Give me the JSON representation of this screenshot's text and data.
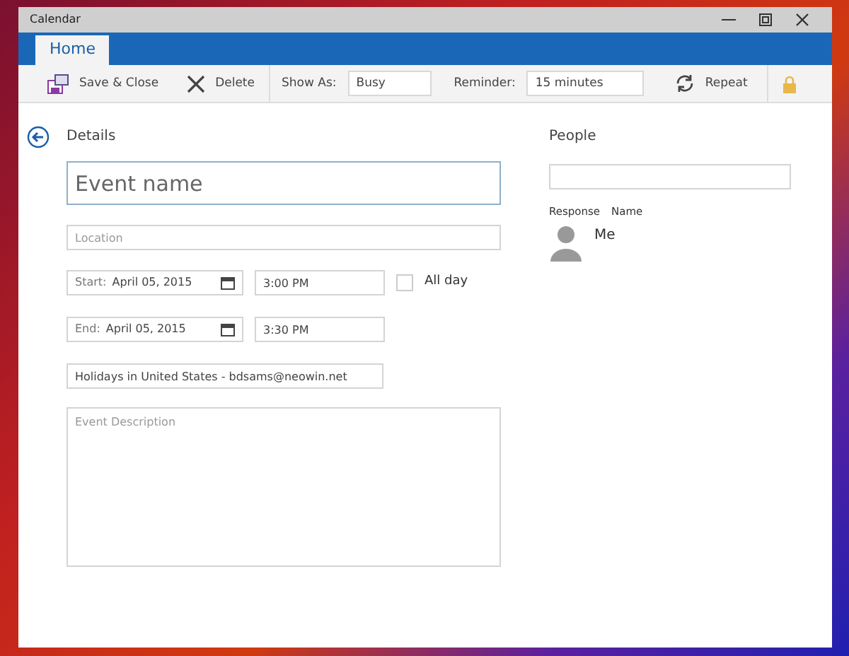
{
  "window": {
    "title": "Calendar"
  },
  "tabs": [
    {
      "label": "Home",
      "selected": true
    }
  ],
  "toolbar": {
    "save_close": "Save & Close",
    "delete": "Delete",
    "show_as_label": "Show As:",
    "show_as_value": "Busy",
    "reminder_label": "Reminder:",
    "reminder_value": "15 minutes",
    "repeat": "Repeat"
  },
  "details": {
    "heading": "Details",
    "event_name": {
      "placeholder": "Event name"
    },
    "location": {
      "placeholder": "Location"
    },
    "start": {
      "label": "Start:",
      "date": "April 05, 2015",
      "time": "3:00 PM"
    },
    "all_day": {
      "label": "All day",
      "checked": false
    },
    "end": {
      "label": "End:",
      "date": "April 05, 2015",
      "time": "3:30 PM"
    },
    "calendar": "Holidays in United States - bdsams@neowin.net",
    "description": {
      "placeholder": "Event Description"
    }
  },
  "people": {
    "heading": "People",
    "columns": [
      "Response",
      "Name"
    ],
    "attendees": [
      {
        "name": "Me"
      }
    ]
  }
}
